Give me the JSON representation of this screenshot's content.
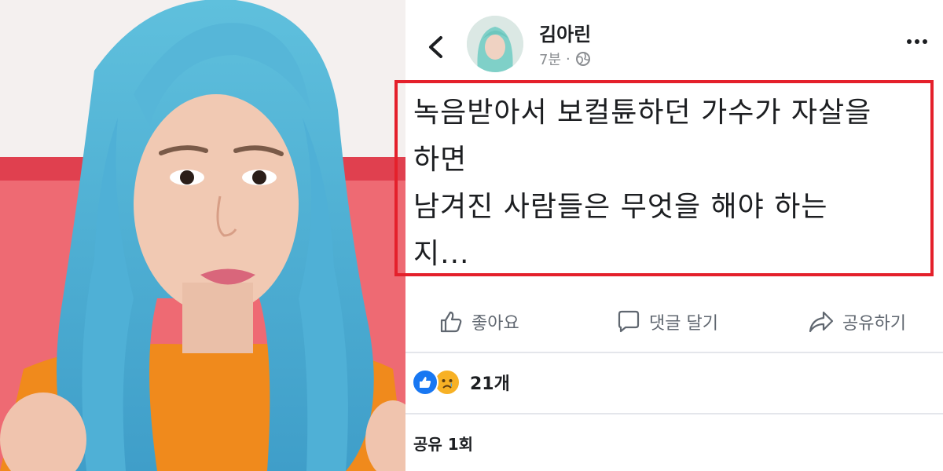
{
  "post": {
    "author_name": "김아린",
    "timestamp": "7분",
    "separator": "·",
    "text_lines": [
      "녹음받아서 보컬튠하던 가수가 자살을",
      "하면",
      "남겨진 사람들은 무엇을 해야 하는",
      "지..."
    ]
  },
  "actions": {
    "like_label": "좋아요",
    "comment_label": "댓글 달기",
    "share_label": "공유하기"
  },
  "reactions": {
    "count_label": "21개"
  },
  "shares": {
    "label": "공유 1회"
  },
  "icons": [
    "back-arrow-icon",
    "globe-icon",
    "more-options-icon",
    "thumbs-up-icon",
    "comment-icon",
    "share-arrow-icon",
    "like-reaction-icon",
    "sad-reaction-icon"
  ],
  "colors": {
    "highlight_box": "#e4202b",
    "text": "#1c1e21",
    "muted": "#606770",
    "like_blue": "#1877f2",
    "sad_yellow": "#f7b125"
  }
}
